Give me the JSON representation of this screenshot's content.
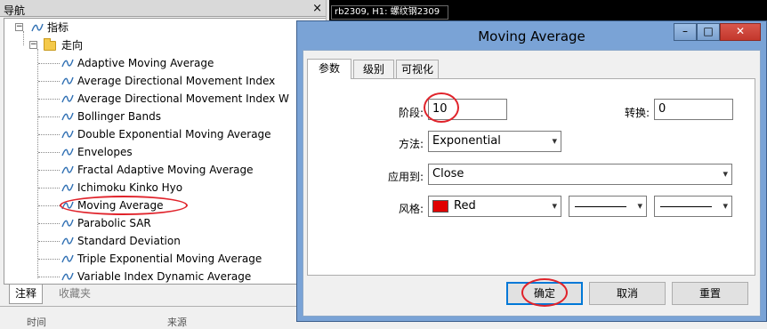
{
  "navigator": {
    "title": "导航",
    "close_symbol": "×",
    "root_label": "指标",
    "folder_label": "走向",
    "items": [
      {
        "label": "Adaptive Moving Average"
      },
      {
        "label": "Average Directional Movement Index"
      },
      {
        "label": "Average Directional Movement Index W"
      },
      {
        "label": "Bollinger Bands"
      },
      {
        "label": "Double Exponential Moving Average"
      },
      {
        "label": "Envelopes"
      },
      {
        "label": "Fractal Adaptive Moving Average"
      },
      {
        "label": "Ichimoku Kinko Hyo"
      },
      {
        "label": "Moving Average"
      },
      {
        "label": "Parabolic SAR"
      },
      {
        "label": "Standard Deviation"
      },
      {
        "label": "Triple Exponential Moving Average"
      },
      {
        "label": "Variable Index Dynamic Average"
      }
    ],
    "tabs": [
      {
        "label": "注释",
        "active": true
      },
      {
        "label": "收藏夹",
        "active": false
      }
    ],
    "bottom_columns": [
      "时间",
      "来源"
    ]
  },
  "chart": {
    "title": "rb2309, H1: 螺纹钢2309"
  },
  "dialog": {
    "title": "Moving Average",
    "titlebar_buttons": {
      "minimize": "–",
      "maximize": "□",
      "close": "✕"
    },
    "tabs": [
      {
        "label": "参数",
        "active": true
      },
      {
        "label": "级别",
        "active": false
      },
      {
        "label": "可视化",
        "active": false
      }
    ],
    "period_label": "阶段:",
    "period_value": "10",
    "shift_label": "转换:",
    "shift_value": "0",
    "method_label": "方法:",
    "method_value": "Exponential",
    "apply_label": "应用到:",
    "apply_value": "Close",
    "style_label": "风格:",
    "color_value": "Red",
    "color_hex": "#e00000",
    "ok_label": "确定",
    "cancel_label": "取消",
    "reset_label": "重置"
  },
  "colors": {
    "annotation_red": "#e0232b",
    "titlebar_blue": "#7aa3d6",
    "close_red": "#c3372c"
  }
}
